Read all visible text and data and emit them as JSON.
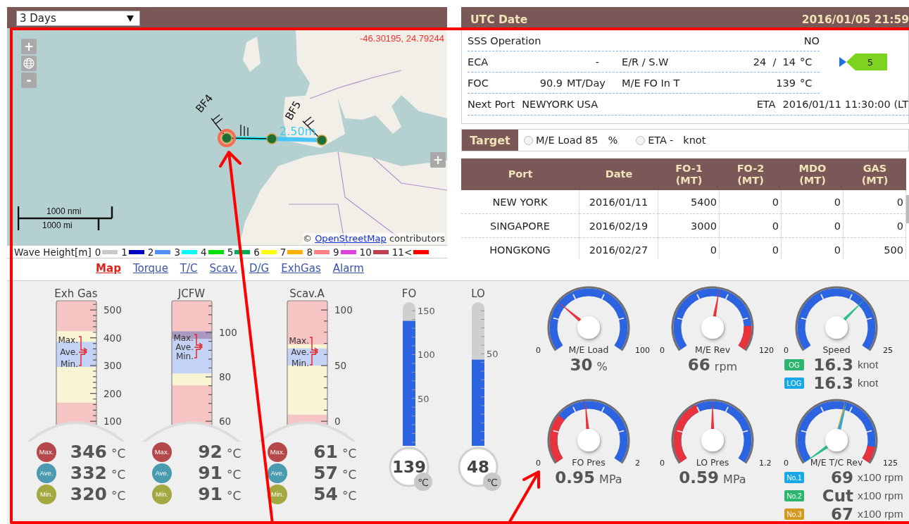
{
  "period_select": {
    "value": "3 Days"
  },
  "map": {
    "coordinates": "-46.30195, 24.79244",
    "controls": [
      "+",
      "-"
    ],
    "expand": "+",
    "wind": [
      "BF4",
      "BF5"
    ],
    "wave_label": "2.50m",
    "scale": [
      "1000 nmi",
      "1000 mi"
    ],
    "attribution": {
      "before": "©",
      "link": "OpenStreetMap",
      "after": "contributors"
    }
  },
  "wave_legend": {
    "title": "Wave Height[m]",
    "steps": [
      {
        "label": "0",
        "color": "#c8c8c8"
      },
      {
        "label": "1",
        "color": "#0000c0"
      },
      {
        "label": "2",
        "color": "#5090ff"
      },
      {
        "label": "3",
        "color": "#00ffff"
      },
      {
        "label": "4",
        "color": "#00e000"
      },
      {
        "label": "5",
        "color": "#00b050"
      },
      {
        "label": "6",
        "color": "#ffff00"
      },
      {
        "label": "7",
        "color": "#ffb000"
      },
      {
        "label": "8",
        "color": "#ff8080"
      },
      {
        "label": "9",
        "color": "#e040e0"
      },
      {
        "label": "10",
        "color": "#c04050"
      },
      {
        "label": "11<",
        "color": "#ff0000"
      }
    ]
  },
  "view_tabs": [
    {
      "label": "Map",
      "selected": true
    },
    {
      "label": "Torque",
      "selected": false
    },
    {
      "label": "T/C",
      "selected": false
    },
    {
      "label": "Scav.",
      "selected": false
    },
    {
      "label": "D/G",
      "selected": false
    },
    {
      "label": "ExhGas",
      "selected": false
    },
    {
      "label": "Alarm",
      "selected": false
    }
  ],
  "utc": {
    "label": "UTC Date",
    "value": "2016/01/05 21:59"
  },
  "info": {
    "sss": {
      "label": "SSS Operation",
      "value": "NO"
    },
    "eca": {
      "label": "ECA",
      "value": "-"
    },
    "er_sw": {
      "label": "E/R / S.W",
      "value": "24  /  14",
      "unit": "°C"
    },
    "foc": {
      "label": "FOC",
      "value": "90.9",
      "unit": "MT/Day"
    },
    "fo_in": {
      "label": "M/E FO In T",
      "value": "139",
      "unit": "°C"
    },
    "next_port": {
      "label": "Next Port",
      "value": "NEWYORK USA"
    },
    "eta": {
      "label": "ETA",
      "value": "2016/01/11 11:30:00 (LT"
    },
    "flag": "5"
  },
  "target": {
    "label": "Target",
    "options": [
      {
        "label": "M/E Load",
        "value": "85",
        "unit": "%",
        "selected": false
      },
      {
        "label": "ETA",
        "value": "-",
        "unit": "knot",
        "selected": false
      }
    ]
  },
  "bunker_table": {
    "columns": [
      {
        "label": "Port"
      },
      {
        "label": "Date"
      },
      {
        "label": "FO-1",
        "unit": "(MT)"
      },
      {
        "label": "FO-2",
        "unit": "(MT)"
      },
      {
        "label": "MDO",
        "unit": "(MT)"
      },
      {
        "label": "GAS",
        "unit": "(MT)"
      }
    ],
    "rows": [
      [
        "NEW YORK",
        "2016/01/11",
        "5400",
        "0",
        "0",
        "0"
      ],
      [
        "SINGAPORE",
        "2016/02/19",
        "3000",
        "0",
        "0",
        "0"
      ],
      [
        "HONGKONG",
        "2016/02/27",
        "0",
        "0",
        "0",
        "500"
      ]
    ]
  },
  "bar_gauges": [
    {
      "title": "Exh Gas",
      "ticks": [
        "500",
        "400",
        "300",
        "200",
        "100"
      ],
      "markers": [
        "Max.",
        "Ave.",
        "Min."
      ],
      "readings": [
        {
          "badge": "Max.",
          "color": "#b5484a",
          "value": "346",
          "unit": "°C"
        },
        {
          "badge": "Ave.",
          "color": "#4a9bb0",
          "value": "332",
          "unit": "°C"
        },
        {
          "badge": "Min.",
          "color": "#a3a840",
          "value": "320",
          "unit": "°C"
        }
      ]
    },
    {
      "title": "JCFW",
      "ticks": [
        "100",
        "80",
        "60"
      ],
      "markers": [
        "Max.",
        "Ave.",
        "Min."
      ],
      "readings": [
        {
          "badge": "Max.",
          "color": "#b5484a",
          "value": "92",
          "unit": "°C"
        },
        {
          "badge": "Ave.",
          "color": "#4a9bb0",
          "value": "91",
          "unit": "°C"
        },
        {
          "badge": "Min.",
          "color": "#a3a840",
          "value": "91",
          "unit": "°C"
        }
      ]
    },
    {
      "title": "Scav.A",
      "ticks": [
        "100",
        "50",
        "0"
      ],
      "markers": [
        "Max.",
        "Ave.",
        "Min."
      ],
      "readings": [
        {
          "badge": "Max.",
          "color": "#b5484a",
          "value": "61",
          "unit": "°C"
        },
        {
          "badge": "Ave.",
          "color": "#4a9bb0",
          "value": "57",
          "unit": "°C"
        },
        {
          "badge": "Min.",
          "color": "#a3a840",
          "value": "54",
          "unit": "°C"
        }
      ]
    }
  ],
  "tube_gauges": [
    {
      "title": "FO",
      "ticks": [
        "150",
        "100",
        "50"
      ],
      "level": 0.87,
      "value": "139",
      "unit": "℃"
    },
    {
      "title": "LO",
      "ticks": [
        "50"
      ],
      "level": 0.6,
      "value": "48",
      "unit": "℃"
    }
  ],
  "dials": [
    {
      "title": "M/E Load",
      "min": "0",
      "max": "100",
      "needles": [
        {
          "color": "#e8333a"
        }
      ],
      "readings": [
        {
          "value": "30",
          "unit": "%"
        }
      ]
    },
    {
      "title": "M/E Rev",
      "min": "0",
      "max": "120",
      "needles": [
        {
          "color": "#e8333a"
        }
      ],
      "readings": [
        {
          "value": "66",
          "unit": "rpm"
        }
      ]
    },
    {
      "title": "Speed",
      "min": "0",
      "max": "25",
      "needles": [
        {
          "color": "#2fbf8a"
        }
      ],
      "readings": [
        {
          "badge": "OG",
          "color": "#2bb56e",
          "value": "16.3",
          "unit": "knot"
        },
        {
          "badge": "LOG",
          "color": "#18a8e8",
          "value": "16.3",
          "unit": "knot"
        }
      ]
    },
    {
      "title": "FO Pres",
      "min": "0",
      "max": "2",
      "needles": [
        {
          "color": "#e8333a"
        }
      ],
      "readings": [
        {
          "value": "0.95",
          "unit": "MPa"
        }
      ]
    },
    {
      "title": "LO Pres",
      "min": "0",
      "max": "1.2",
      "needles": [
        {
          "color": "#e8333a"
        }
      ],
      "readings": [
        {
          "value": "0.59",
          "unit": "MPa"
        }
      ]
    },
    {
      "title": "M/E T/C Rev",
      "min": "0",
      "max": "125",
      "needles": [
        {
          "color": "#2fbf8a"
        },
        {
          "color": "#d49a20"
        },
        {
          "color": "#29a8e0"
        }
      ],
      "readings": [
        {
          "badge": "No.1",
          "color": "#18a8e8",
          "value": "69",
          "unit": "x100 rpm"
        },
        {
          "badge": "No.2",
          "color": "#2bb56e",
          "value": "Cut",
          "unit": "x100 rpm"
        },
        {
          "badge": "No.3",
          "color": "#d49a20",
          "value": "67",
          "unit": "x100 rpm"
        }
      ]
    }
  ]
}
